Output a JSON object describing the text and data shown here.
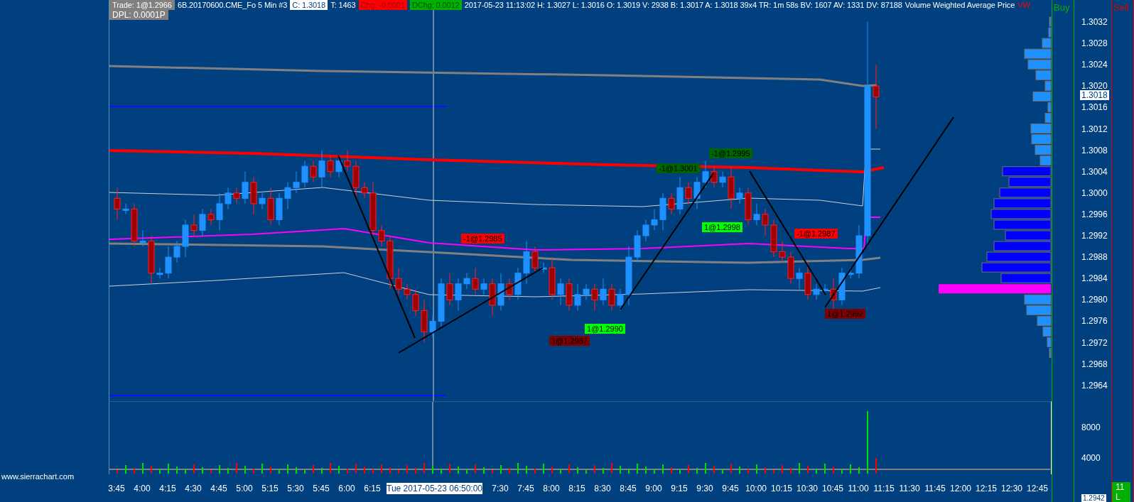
{
  "header": {
    "segments": [
      {
        "text": "Trade: 1@1.2966",
        "kind": "gray"
      },
      {
        "text": "6B.20170600.CME_Fo  5 Min  #3",
        "kind": "plain"
      },
      {
        "text": "C: 1.3018",
        "kind": "white"
      },
      {
        "text": "T: 1463",
        "kind": "plain"
      },
      {
        "text": "Chg: -0.0001",
        "kind": "red"
      },
      {
        "text": "DChg: 0.0012",
        "kind": "green"
      },
      {
        "text": "2017-05-23 11:13:02 H: 1.3027 L: 1.3016 O: 1.3019 V: 2938 B: 1.3017 A: 1.3018 39x4 TR: 1m 58s BV: 1607 AV: 1331 DV: 87188",
        "kind": "plain"
      },
      {
        "text": "Volume Weighted Average Price",
        "kind": "plain"
      },
      {
        "text": "VW",
        "kind": "alert"
      }
    ],
    "dpl": "DPL: 0.0001P"
  },
  "trade_tags": [
    {
      "text": "-1@1.2985",
      "color": "#ff0000"
    },
    {
      "text": "1@1.2987",
      "color": "#800000"
    },
    {
      "text": "1@1.2990",
      "color": "#00ff00"
    },
    {
      "text": "-1@1.3001",
      "color": "#006400"
    },
    {
      "text": "-1@1.2995",
      "color": "#006400"
    },
    {
      "text": "1@1.2998",
      "color": "#00ff00"
    },
    {
      "text": "-1@1.2987",
      "color": "#ff0000"
    },
    {
      "text": "1@1.2992",
      "color": "#800000"
    }
  ],
  "price_axis": {
    "labels": [
      "1.3032",
      "1.3028",
      "1.3024",
      "1.3020",
      "1.3016",
      "1.3012",
      "1.3008",
      "1.3004",
      "1.3000",
      "1.2996",
      "1.2992",
      "1.2988",
      "1.2984",
      "1.2980",
      "1.2976",
      "1.2972",
      "1.2968",
      "1.2964"
    ],
    "current_price": "1.3018"
  },
  "volume_axis": {
    "labels": [
      "8000",
      "4000"
    ]
  },
  "dom": {
    "buy_label": "Buy",
    "sell_label": "Sell",
    "bottom_price": "1.2942",
    "bottom_badge": "11 L"
  },
  "time_axis": {
    "labels": [
      "3:45",
      "4:00",
      "4:15",
      "4:30",
      "4:45",
      "5:00",
      "5:15",
      "5:30",
      "5:45",
      "6:00",
      "6:15",
      "7:30",
      "7:45",
      "8:00",
      "8:15",
      "8:30",
      "8:45",
      "9:00",
      "9:15",
      "9:30",
      "9:45",
      "10:00",
      "10:15",
      "10:30",
      "10:45",
      "11:00",
      "11:15",
      "11:30",
      "11:45",
      "12:00",
      "12:15",
      "12:30",
      "12:45"
    ],
    "cursor_label": "Tue 2017-05-23  06:50:00"
  },
  "footer": {
    "website": "www.sierrachart.com"
  }
}
